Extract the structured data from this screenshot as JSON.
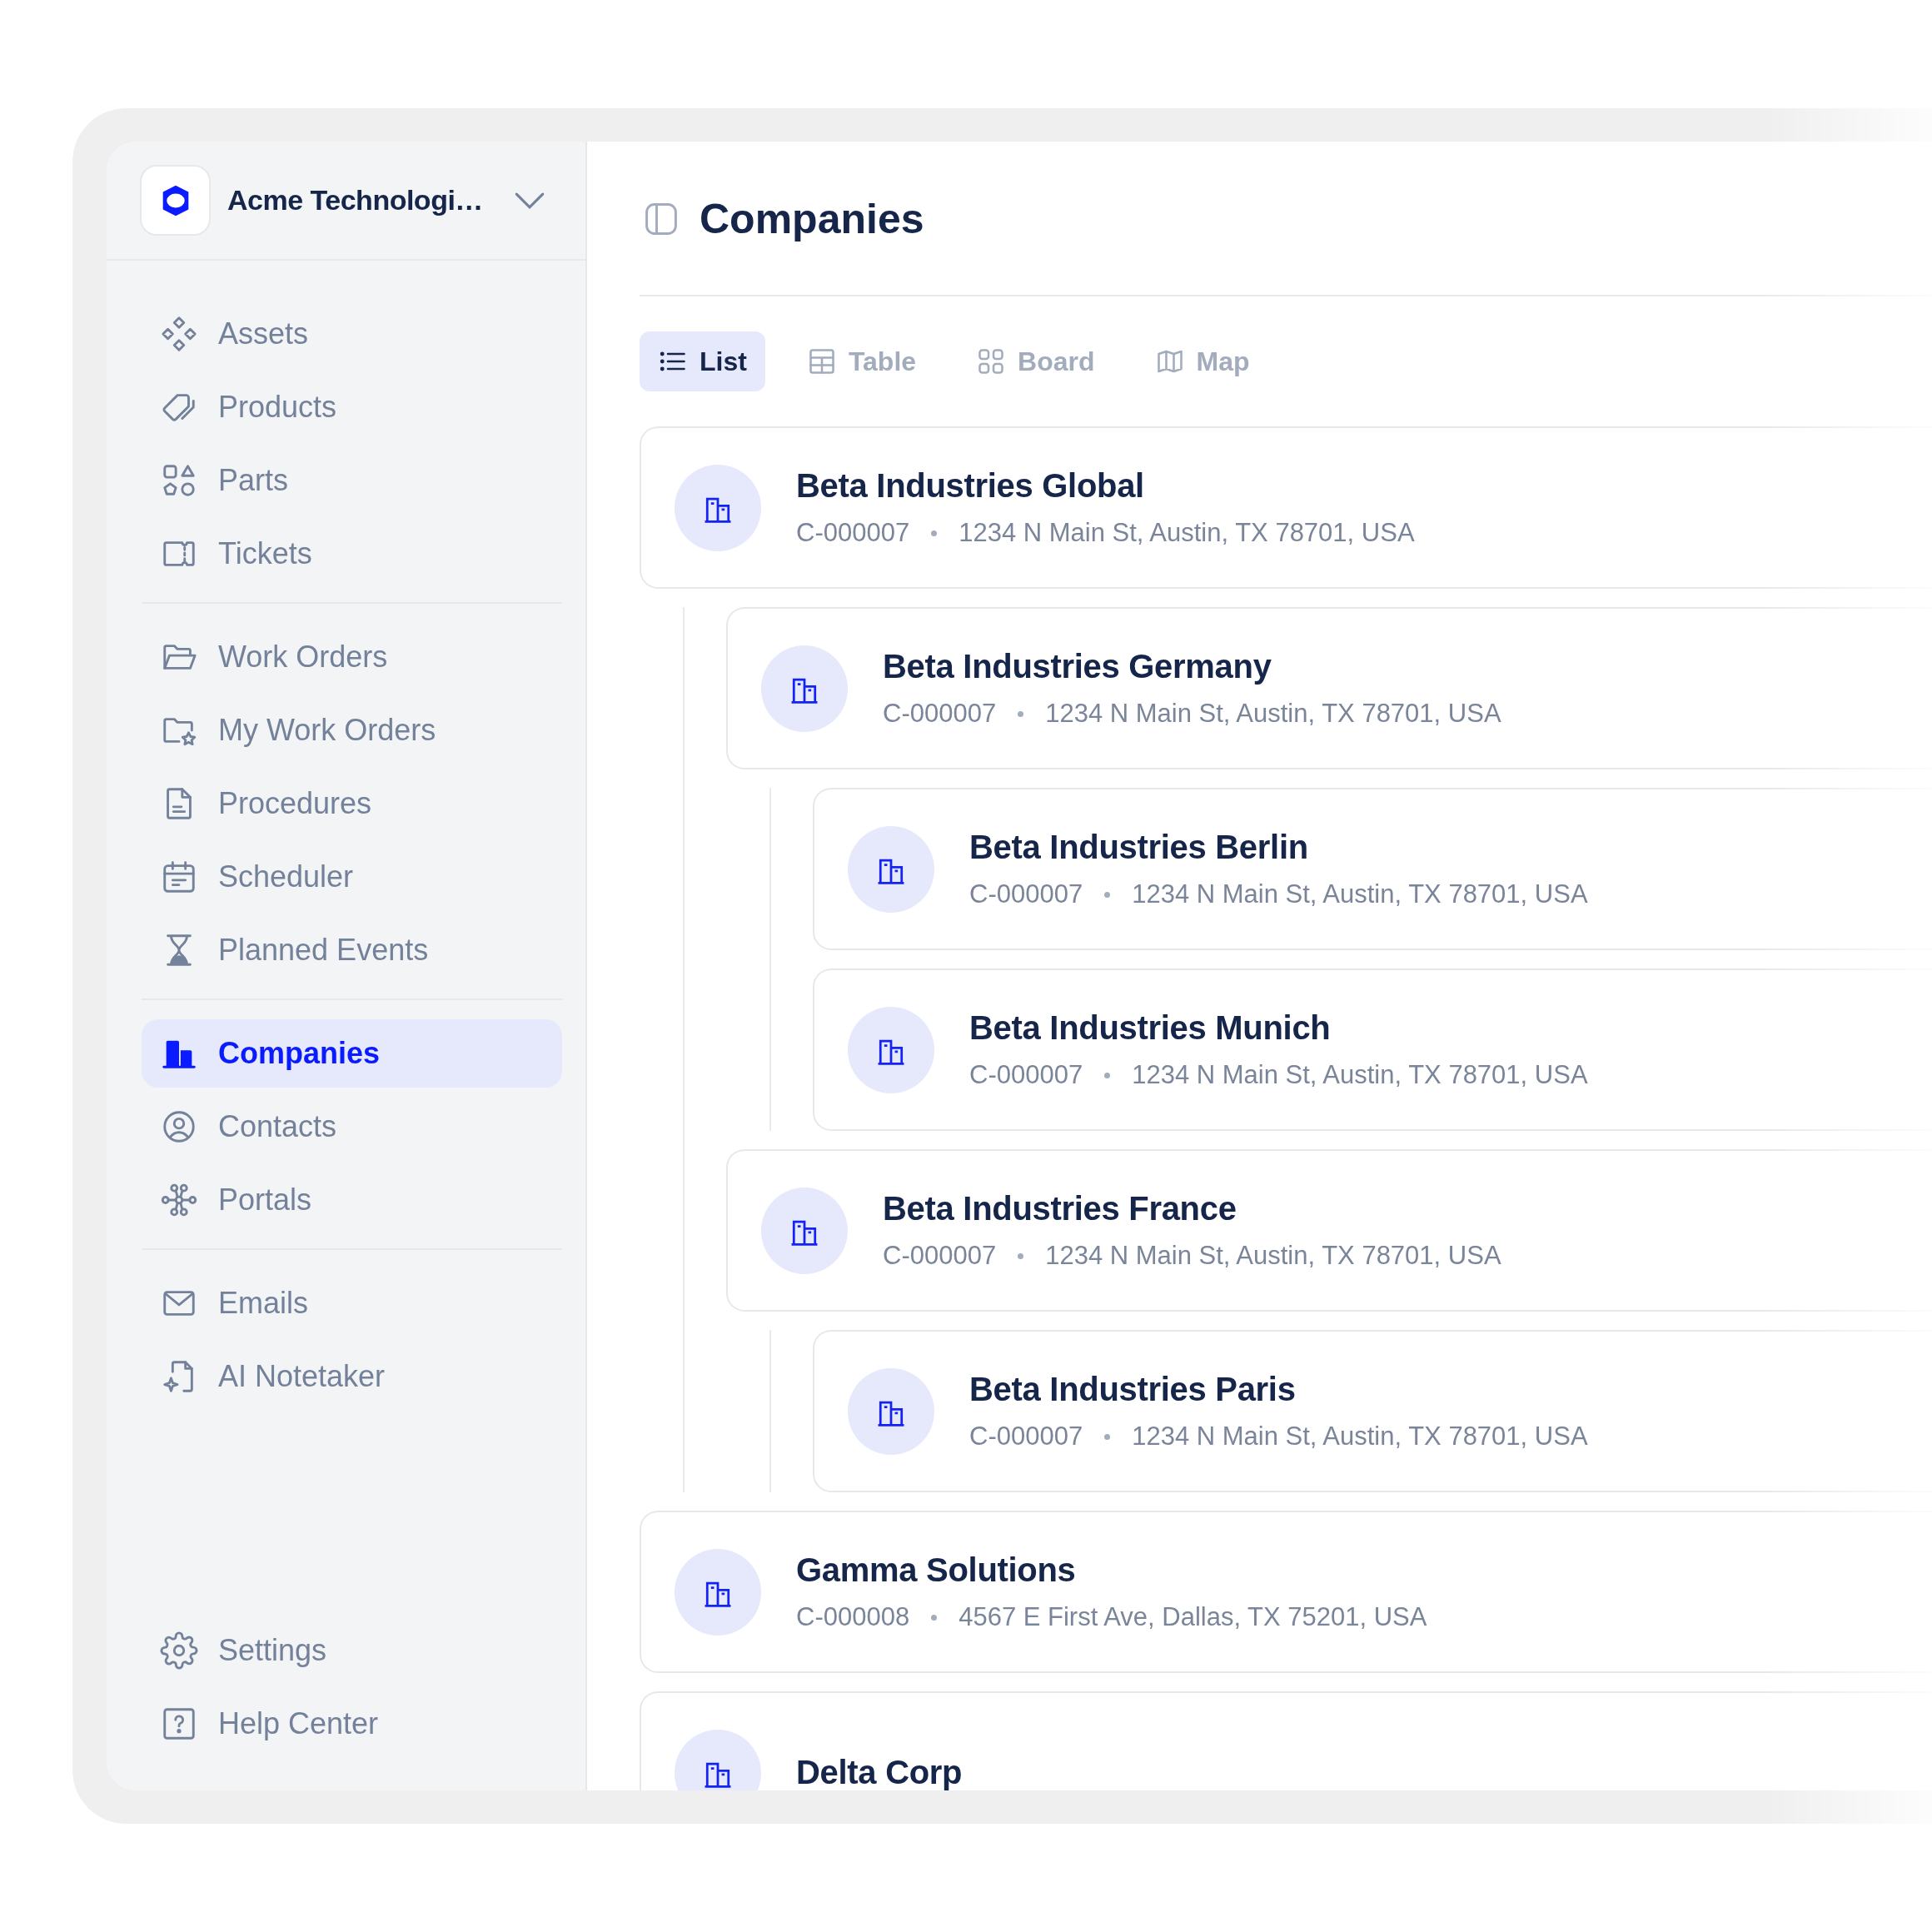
{
  "workspace": {
    "name": "Acme Technologi…"
  },
  "sidebar": {
    "groups": [
      {
        "items": [
          {
            "label": "Assets",
            "selected": false
          },
          {
            "label": "Products",
            "selected": false
          },
          {
            "label": "Parts",
            "selected": false
          },
          {
            "label": "Tickets",
            "selected": false
          }
        ]
      },
      {
        "items": [
          {
            "label": "Work Orders",
            "selected": false
          },
          {
            "label": "My Work Orders",
            "selected": false
          },
          {
            "label": "Procedures",
            "selected": false
          },
          {
            "label": "Scheduler",
            "selected": false
          },
          {
            "label": "Planned Events",
            "selected": false
          }
        ]
      },
      {
        "items": [
          {
            "label": "Companies",
            "selected": true
          },
          {
            "label": "Contacts",
            "selected": false
          },
          {
            "label": "Portals",
            "selected": false
          }
        ]
      },
      {
        "items": [
          {
            "label": "Emails",
            "selected": false
          },
          {
            "label": "AI Notetaker",
            "selected": false
          }
        ]
      }
    ],
    "footer_items": [
      {
        "label": "Settings",
        "selected": false
      },
      {
        "label": "Help Center",
        "selected": false
      }
    ]
  },
  "page": {
    "title": "Companies"
  },
  "view_tabs": [
    {
      "label": "List",
      "selected": true
    },
    {
      "label": "Table",
      "selected": false
    },
    {
      "label": "Board",
      "selected": false
    },
    {
      "label": "Map",
      "selected": false
    }
  ],
  "companies": [
    {
      "name": "Beta Industries Global",
      "code": "C-000007",
      "address": "1234 N Main St, Austin, TX 78701, USA",
      "children": [
        {
          "name": "Beta Industries Germany",
          "code": "C-000007",
          "address": "1234 N Main St, Austin, TX 78701, USA",
          "children": [
            {
              "name": "Beta Industries Berlin",
              "code": "C-000007",
              "address": "1234 N Main St, Austin, TX 78701, USA"
            },
            {
              "name": "Beta Industries Munich",
              "code": "C-000007",
              "address": "1234 N Main St, Austin, TX 78701, USA"
            }
          ]
        },
        {
          "name": "Beta Industries France",
          "code": "C-000007",
          "address": "1234 N Main St, Austin, TX 78701, USA",
          "children": [
            {
              "name": "Beta Industries Paris",
              "code": "C-000007",
              "address": "1234 N Main St, Austin, TX 78701, USA"
            }
          ]
        }
      ]
    },
    {
      "name": "Gamma Solutions",
      "code": "C-000008",
      "address": "4567 E First Ave, Dallas, TX 75201, USA"
    },
    {
      "name": "Delta Corp"
    }
  ]
}
